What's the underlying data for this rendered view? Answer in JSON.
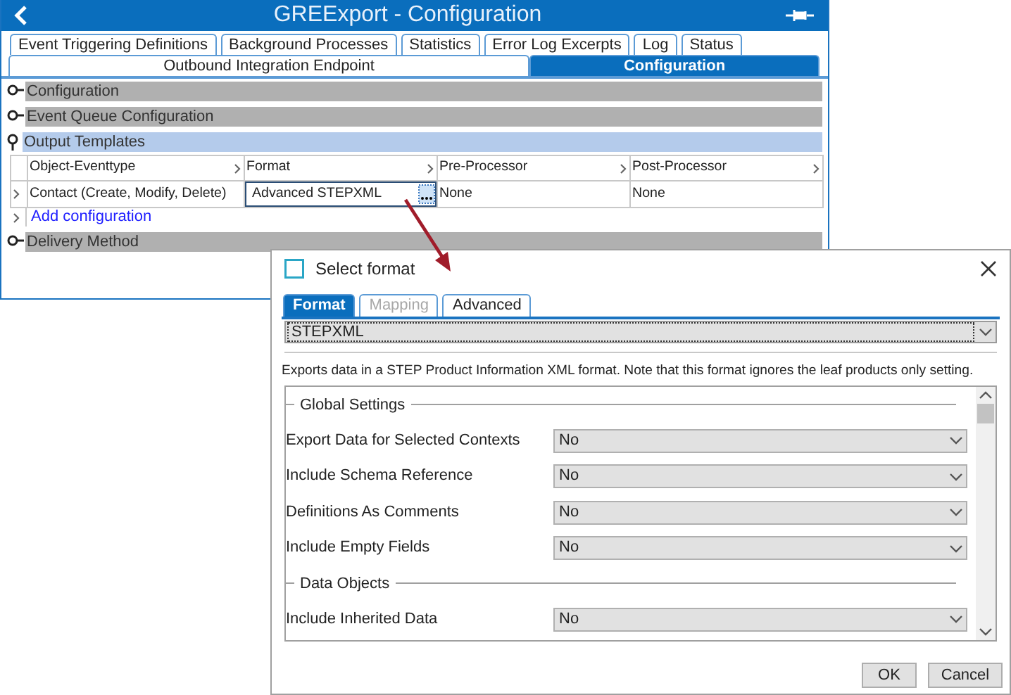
{
  "window": {
    "title": "GREExport - Configuration"
  },
  "tabs": [
    {
      "label": "Event Triggering Definitions",
      "selected": false
    },
    {
      "label": "Background Processes",
      "selected": false
    },
    {
      "label": "Statistics",
      "selected": false
    },
    {
      "label": "Error Log Excerpts",
      "selected": false
    },
    {
      "label": "Log",
      "selected": false
    },
    {
      "label": "Status",
      "selected": false
    }
  ],
  "subtabs": [
    {
      "label": "Outbound Integration Endpoint",
      "selected": false
    },
    {
      "label": "Configuration",
      "selected": true
    }
  ],
  "sections": [
    {
      "title": "Configuration",
      "expanded": false
    },
    {
      "title": "Event Queue Configuration",
      "expanded": false
    },
    {
      "title": "Output Templates",
      "expanded": true,
      "table": {
        "columns": [
          "Object-Eventtype",
          "Format",
          "Pre-Processor",
          "Post-Processor"
        ],
        "rows": [
          {
            "cells": [
              {
                "text": "Contact (Create, Modify, Delete)",
                "editing": false
              },
              {
                "text": "Advanced STEPXML",
                "editing": true
              },
              {
                "text": "None",
                "editing": false
              },
              {
                "text": "None",
                "editing": false
              }
            ]
          }
        ],
        "add_link": "Add configuration"
      }
    },
    {
      "title": "Delivery Method",
      "expanded": false
    }
  ],
  "dialog": {
    "title": "Select format",
    "tabs": [
      {
        "label": "Format",
        "selected": true,
        "disabled": false
      },
      {
        "label": "Mapping",
        "selected": false,
        "disabled": true
      },
      {
        "label": "Advanced",
        "selected": false,
        "disabled": false
      }
    ],
    "format": "STEPXML",
    "description": "Exports data in a STEP Product Information XML format. Note that this format ignores the leaf products only setting.",
    "settings": [
      {
        "kind": "group",
        "label": "Global Settings"
      },
      {
        "kind": "select",
        "label": "Export Data for Selected Contexts",
        "value": "No"
      },
      {
        "kind": "select",
        "label": "Include Schema Reference",
        "value": "No"
      },
      {
        "kind": "select",
        "label": "Definitions As Comments",
        "value": "No"
      },
      {
        "kind": "select",
        "label": "Include Empty Fields",
        "value": "No"
      },
      {
        "kind": "group",
        "label": "Data Objects"
      },
      {
        "kind": "select",
        "label": "Include Inherited Data",
        "value": "No"
      }
    ],
    "buttons": [
      "OK",
      "Cancel"
    ]
  }
}
